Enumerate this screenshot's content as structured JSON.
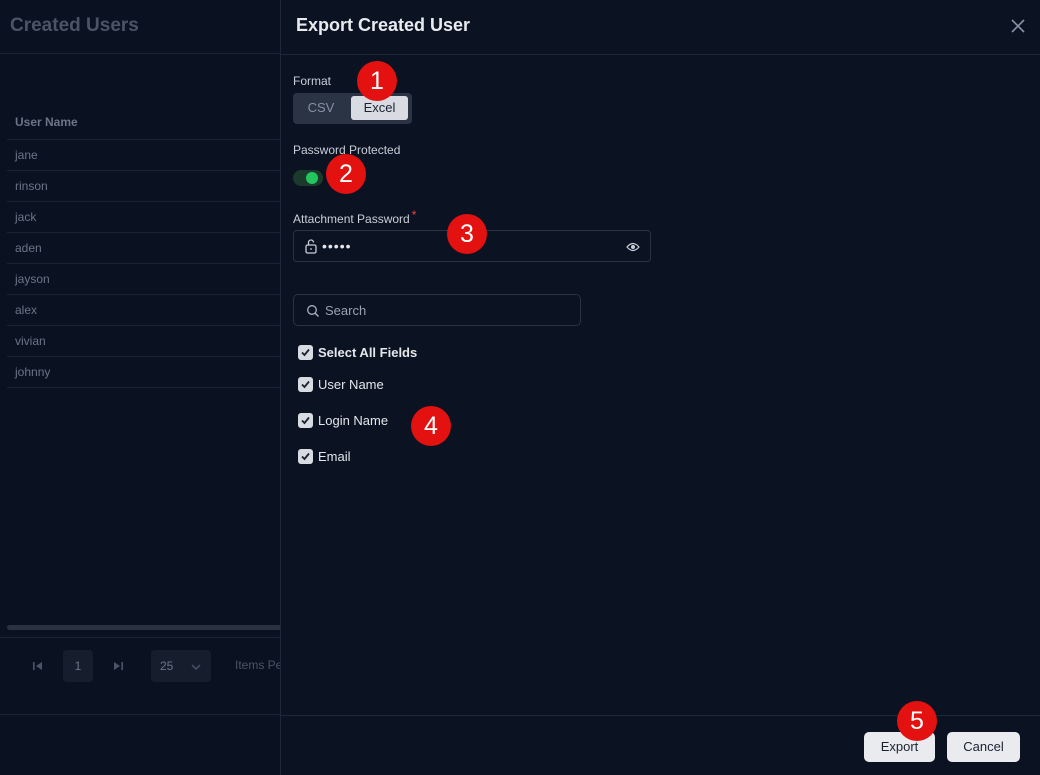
{
  "background": {
    "title": "Created Users",
    "table": {
      "header": "User Name",
      "rows": [
        "jane",
        "rinson",
        "jack",
        "aden",
        "jayson",
        "alex",
        "vivian",
        "johnny"
      ]
    },
    "pager": {
      "current_page": "1",
      "page_size": "25",
      "items_per_page_label": "Items Pe"
    }
  },
  "panel": {
    "title": "Export Created User",
    "format": {
      "label": "Format",
      "options": [
        "CSV",
        "Excel"
      ],
      "selected": "Excel"
    },
    "password_protected": {
      "label": "Password Protected",
      "enabled": true
    },
    "attachment_password": {
      "label": "Attachment Password",
      "required_mark": "*",
      "value": "•••••"
    },
    "search": {
      "placeholder": "Search"
    },
    "fields": {
      "select_all_label": "Select All Fields",
      "items": [
        {
          "label": "User Name",
          "checked": true
        },
        {
          "label": "Login Name",
          "checked": true
        },
        {
          "label": "Email",
          "checked": true
        }
      ]
    },
    "footer": {
      "export_label": "Export",
      "cancel_label": "Cancel"
    }
  },
  "markers": [
    "1",
    "2",
    "3",
    "4",
    "5"
  ],
  "colors": {
    "accent_green": "#22c55e",
    "marker_red": "#e3110f",
    "required_red": "#ef4444"
  }
}
